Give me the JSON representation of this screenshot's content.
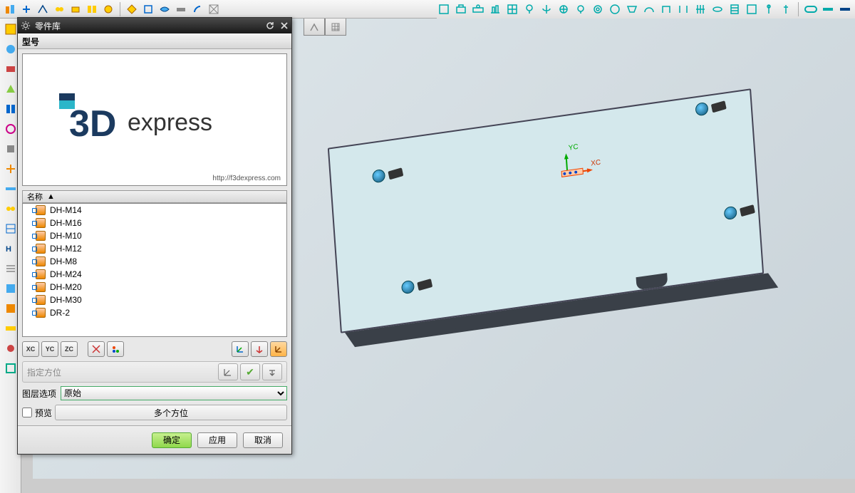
{
  "dialog": {
    "title": "零件库",
    "section_model": "型号",
    "logo_text_main": "3D",
    "logo_text_sub": "express",
    "logo_url": "http://f3dexpress.com",
    "name_col": "名称",
    "items": [
      "DH-M14",
      "DH-M16",
      "DH-M10",
      "DH-M12",
      "DH-M8",
      "DH-M24",
      "DH-M20",
      "DH-M30",
      "DR-2"
    ],
    "xc": "XC",
    "yc": "YC",
    "zc": "ZC",
    "orient_label": "指定方位",
    "layer_label": "图层选项",
    "layer_value": "原始",
    "preview_label": "预览",
    "multi_label": "多个方位",
    "ok": "确定",
    "apply": "应用",
    "cancel": "取消"
  },
  "axes": {
    "yc": "YC",
    "xc": "XC"
  }
}
